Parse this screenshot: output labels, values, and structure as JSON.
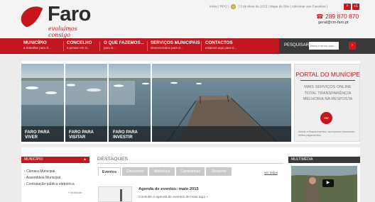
{
  "header": {
    "logo_text": "Faro",
    "logo_tagline": "evoluímos consigo",
    "toplinks_left": "Início | RPG |",
    "toplinks_right": "| 3 de Maio de 2015 | Mapa do Site | Adicionar aos Favoritos |",
    "social": [
      "f",
      "+1"
    ],
    "phone": "289 870 870",
    "email": "geral@cm-faro.pt"
  },
  "nav": {
    "items": [
      {
        "title": "MUNICÍPIO",
        "subtitle": "a trabalhar para si..."
      },
      {
        "title": "CONCELHO",
        "subtitle": "a pensar em si..."
      },
      {
        "title": "O QUE FAZEMOS...",
        "subtitle": "para si..."
      },
      {
        "title": "SERVIÇOS MUNICIPAIS",
        "subtitle": "desenvolvidos para si..."
      },
      {
        "title": "CONTACTOS",
        "subtitle": "estamos aqui para si..."
      }
    ],
    "search_label": "PESQUISAR",
    "search_placeholder": "insira o termo aqui",
    "search_button": "›"
  },
  "hero": {
    "tiles": [
      {
        "line1": "FARO PARA",
        "line2": "VIVER"
      },
      {
        "line1": "FARO PARA",
        "line2": "VISITAR"
      },
      {
        "line1": "FARO PARA",
        "line2": "INVESTIR"
      }
    ]
  },
  "portal": {
    "title": "PORTAL DO MUNÍCIPE",
    "lines": [
      "MAIS SERVIÇOS ONLINE",
      "TOTAL TRANSPARÊNCIA",
      "MELHORIA NA RESPOSTA"
    ],
    "button": "Ver",
    "footer": "Aceda a Requerimentos, acompanhe processos, efetue pagamentos."
  },
  "municipio": {
    "title": "MUNICÍPIO",
    "items": [
      "Câmara Municipal",
      "Assembleia Municipal",
      "Contratação pública eletrónica"
    ],
    "more": "» Município"
  },
  "destaques": {
    "title": "DESTAQUES",
    "tabs": [
      "Eventos",
      "Concursos",
      "Biblioteca",
      "Campanhas",
      "Desporto"
    ],
    "active_tab": "Eventos",
    "see_all": "ver todos",
    "event_title": "Agenda de eventos: maio 2015",
    "event_text": "Consulte a agenda de eventos de maio aqui »"
  },
  "multimedia": {
    "title": "MULTIMÉDIA",
    "play_icon": "play-icon"
  },
  "colors": {
    "brand_red": "#c3161e",
    "dark": "#393939"
  }
}
